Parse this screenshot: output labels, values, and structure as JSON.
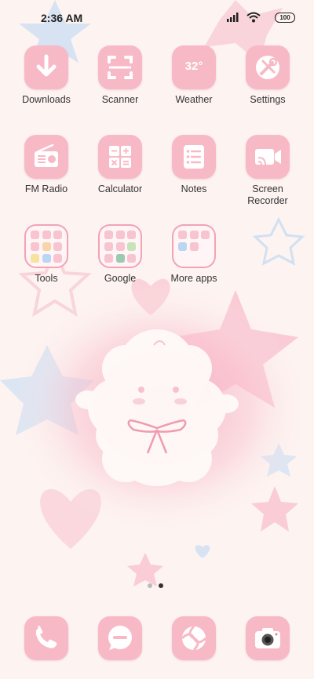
{
  "status_bar": {
    "time": "2:36 AM",
    "battery": "100",
    "icons": [
      "signal-icon",
      "wifi-icon",
      "battery-icon"
    ]
  },
  "home": {
    "row1": [
      {
        "label": "Downloads",
        "icon": "download-icon"
      },
      {
        "label": "Scanner",
        "icon": "scanner-icon"
      },
      {
        "label": "Weather",
        "icon": "weather-icon",
        "value": "32°"
      },
      {
        "label": "Settings",
        "icon": "settings-icon"
      }
    ],
    "row2": [
      {
        "label": "FM Radio",
        "icon": "radio-icon"
      },
      {
        "label": "Calculator",
        "icon": "calculator-icon"
      },
      {
        "label": "Notes",
        "icon": "notes-icon"
      },
      {
        "label": "Screen Recorder",
        "icon": "screen-recorder-icon"
      }
    ],
    "folders": [
      {
        "label": "Tools"
      },
      {
        "label": "Google"
      },
      {
        "label": "More apps"
      }
    ]
  },
  "pager": {
    "pages": 2,
    "current": 2
  },
  "dock": [
    {
      "name": "phone",
      "icon": "phone-icon"
    },
    {
      "name": "messages",
      "icon": "messages-icon"
    },
    {
      "name": "browser",
      "icon": "browser-icon"
    },
    {
      "name": "camera",
      "icon": "camera-icon"
    }
  ],
  "colors": {
    "icon_pink": "#f8b9c6",
    "background": "#fdf3f1",
    "accent_pink": "#f2a3b4",
    "label": "#333333"
  }
}
